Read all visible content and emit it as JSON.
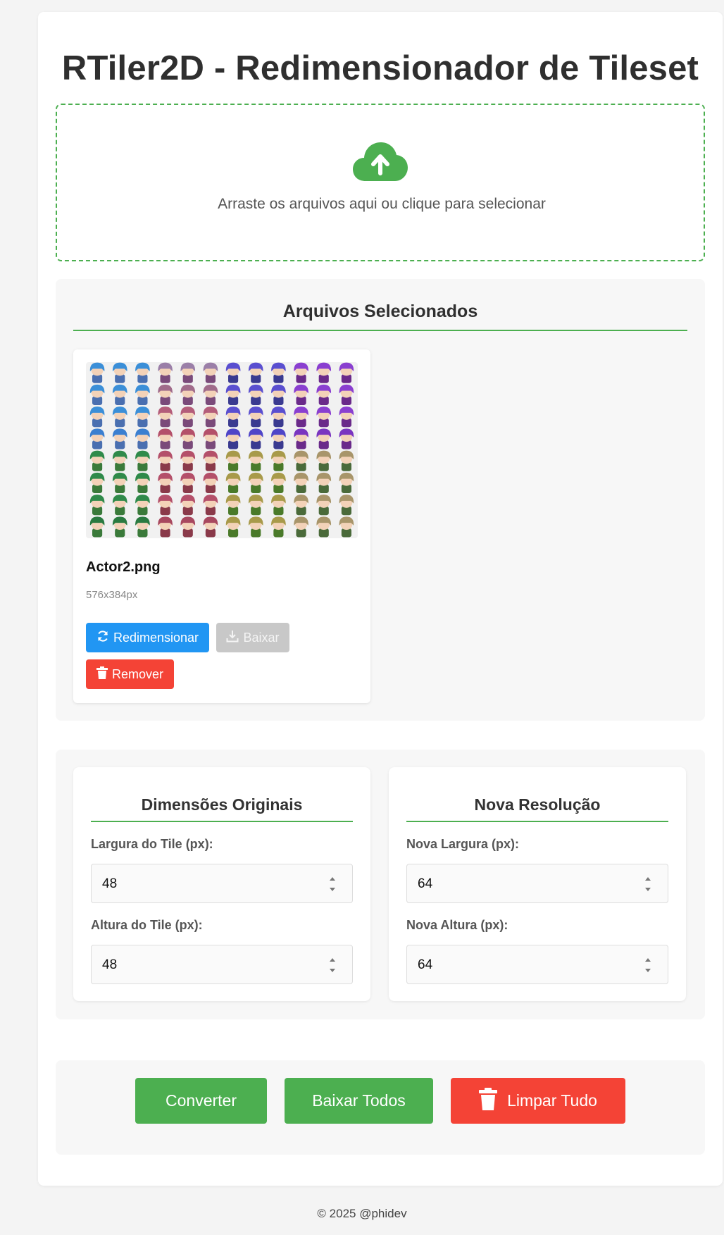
{
  "title": "RTiler2D - Redimensionador de Tileset",
  "dropzone": {
    "icon": "cloud-upload-icon",
    "text": "Arraste os arquivos aqui ou clique para selecionar",
    "accent": "#4caf50"
  },
  "files": {
    "title": "Arquivos Selecionados",
    "items": [
      {
        "name": "Actor2.png",
        "dims": "576x384px",
        "resize_label": "Redimensionar",
        "download_label": "Baixar",
        "remove_label": "Remover"
      }
    ]
  },
  "original": {
    "title": "Dimensões Originais",
    "width_label": "Largura do Tile (px):",
    "width_value": "48",
    "height_label": "Altura do Tile (px):",
    "height_value": "48"
  },
  "new_res": {
    "title": "Nova Resolução",
    "width_label": "Nova Largura (px):",
    "width_value": "64",
    "height_label": "Nova Altura (px):",
    "height_value": "64"
  },
  "actions": {
    "convert_label": "Converter",
    "download_all_label": "Baixar Todos",
    "clear_all_label": "Limpar Tudo"
  },
  "footer": "© 2025 @phidev",
  "colors": {
    "green": "#4caf50",
    "blue": "#2196f3",
    "red": "#f44336",
    "disabled": "#c8c8c8"
  }
}
